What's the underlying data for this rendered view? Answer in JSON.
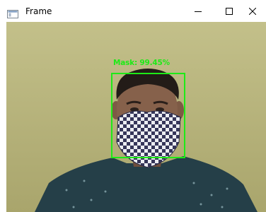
{
  "window": {
    "title": "Frame",
    "icons": {
      "app": "frame-window-icon",
      "minimize": "minimize-icon",
      "maximize": "maximize-icon",
      "close": "close-icon"
    }
  },
  "detection": {
    "label": "Mask: 99.45%",
    "color": "#1eea17"
  }
}
